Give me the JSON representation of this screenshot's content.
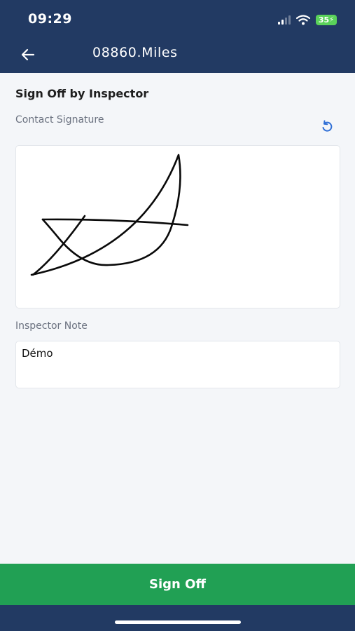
{
  "status_bar": {
    "time": "09:29",
    "battery": "35",
    "icons": [
      "signal-icon",
      "wifi-icon",
      "battery-charging-icon"
    ]
  },
  "nav": {
    "title": "08860.Miles",
    "back_icon": "arrow-left-icon"
  },
  "page": {
    "section_title": "Sign Off by Inspector",
    "signature_label": "Contact Signature",
    "reset_icon": "undo-icon",
    "note_label": "Inspector Note",
    "note_value": "Démo"
  },
  "actions": {
    "sign_off_label": "Sign Off"
  },
  "colors": {
    "header": "#223a63",
    "button": "#21a054",
    "accent": "#2f6fd6",
    "background": "#f4f6f9"
  }
}
